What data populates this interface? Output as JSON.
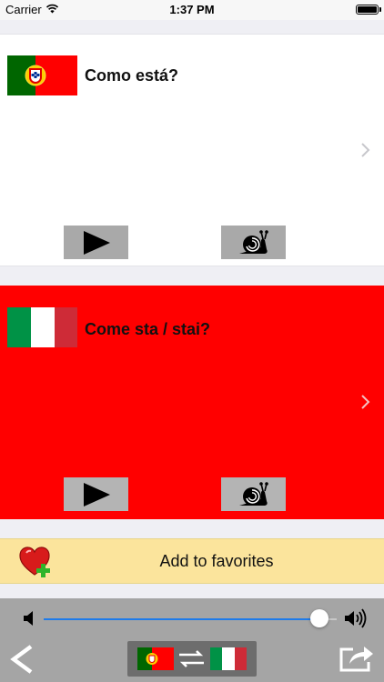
{
  "status_bar": {
    "carrier": "Carrier",
    "time": "1:37 PM"
  },
  "source_card": {
    "flag": "portugal-flag",
    "phrase": "Como está?",
    "play_icon": "play-icon",
    "slow_icon": "snail-icon"
  },
  "target_card": {
    "flag": "italy-flag",
    "phrase": "Come sta / stai?",
    "background": "#ff0000",
    "play_icon": "play-icon",
    "slow_icon": "snail-icon"
  },
  "favorites": {
    "label": "Add to favorites",
    "icon": "heart-plus-icon",
    "background": "#fbe49c"
  },
  "bottom_bar": {
    "volume_level": 0.94,
    "volume_low_icon": "speaker-low-icon",
    "volume_high_icon": "speaker-high-icon",
    "back_label": "<",
    "swap_icon": "swap-arrows-icon",
    "share_icon": "share-icon",
    "accent": "#1e7bea"
  }
}
